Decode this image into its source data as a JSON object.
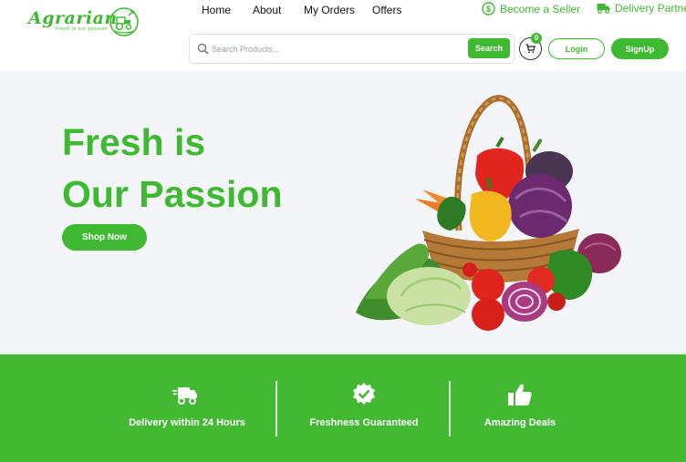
{
  "brand": {
    "name": "Agrarian",
    "tagline": "Fresh is our passion",
    "accent_color": "#3fb931"
  },
  "nav": {
    "items": [
      {
        "label": "Home"
      },
      {
        "label": "About"
      },
      {
        "label": "My Orders"
      },
      {
        "label": "Offers"
      }
    ]
  },
  "top_links": {
    "seller": {
      "label": "Become a Seller",
      "icon": "dollar-coin-icon"
    },
    "delivery": {
      "label": "Delivery Partner",
      "icon": "truck-icon"
    }
  },
  "search": {
    "placeholder": "Search Products...",
    "value": "",
    "button_label": "Search"
  },
  "cart": {
    "count": "0",
    "icon": "cart-icon"
  },
  "auth": {
    "login_label": "Login",
    "signup_label": "SignUp"
  },
  "hero": {
    "title_line1": "Fresh is",
    "title_line2": "Our Passion",
    "cta_label": "Shop Now",
    "image": "vegetable-basket"
  },
  "features": [
    {
      "label": "Delivery within 24 Hours",
      "icon": "delivery-truck-icon"
    },
    {
      "label": "Freshness Guaranteed",
      "icon": "verified-badge-icon"
    },
    {
      "label": "Amazing Deals",
      "icon": "thumbs-up-icon"
    }
  ],
  "colors": {
    "accent": "#3fb931",
    "features_bg": "#43b833",
    "page_bg": "#f3f5f8"
  }
}
